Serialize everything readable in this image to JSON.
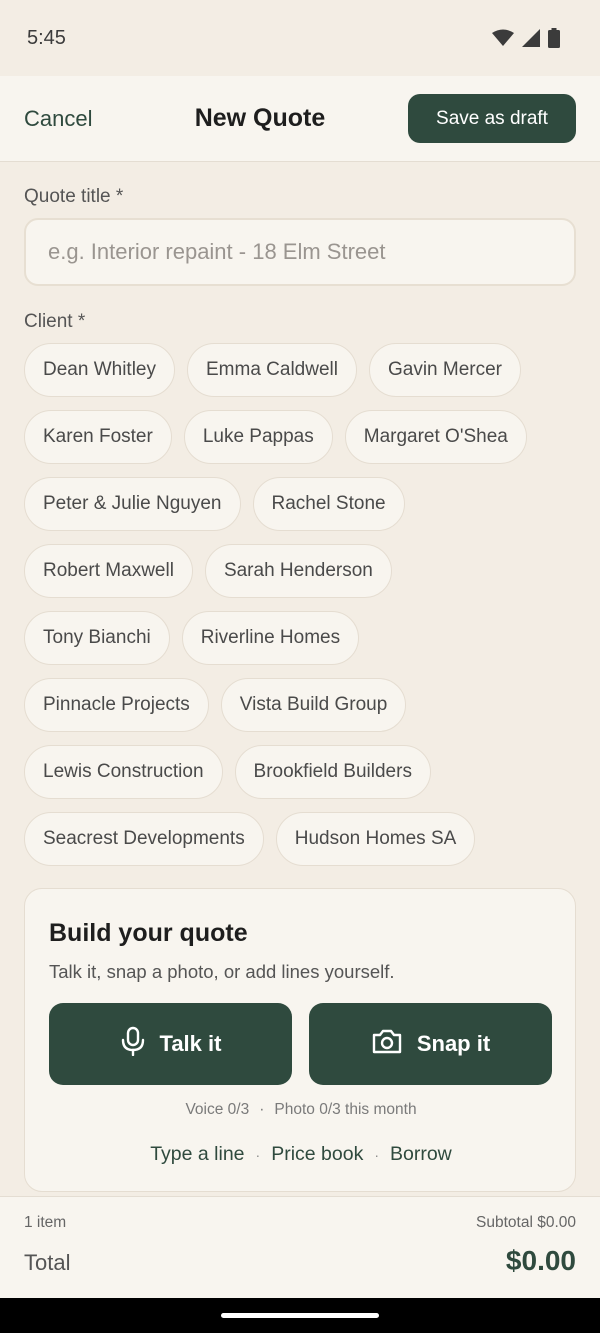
{
  "status_bar": {
    "time": "5:45",
    "icons": [
      "wifi-icon",
      "signal-icon",
      "battery-icon"
    ]
  },
  "header": {
    "cancel_label": "Cancel",
    "title": "New Quote",
    "save_draft_label": "Save as draft"
  },
  "form": {
    "quote_title_label": "Quote title *",
    "quote_title_placeholder": "e.g. Interior repaint - 18 Elm Street",
    "quote_title_value": "",
    "client_label": "Client *",
    "clients": [
      [
        "Dean Whitley",
        "Emma Caldwell",
        "Gavin Mercer"
      ],
      [
        "Karen Foster",
        "Luke Pappas",
        "Margaret O'Shea"
      ],
      [
        "Peter & Julie Nguyen",
        "Rachel Stone"
      ],
      [
        "Robert Maxwell",
        "Sarah Henderson"
      ],
      [
        "Tony Bianchi",
        "Riverline Homes"
      ],
      [
        "Pinnacle Projects",
        "Vista Build Group"
      ],
      [
        "Lewis Construction",
        "Brookfield Builders"
      ],
      [
        "Seacrest Developments",
        "Hudson Homes SA"
      ]
    ]
  },
  "build": {
    "title": "Build your quote",
    "subtitle": "Talk it, snap a photo, or add lines yourself.",
    "talk_label": "Talk it",
    "snap_label": "Snap it",
    "voice_usage": "Voice 0/3",
    "photo_usage": "Photo 0/3 this month",
    "usage_separator": "·",
    "type_line_label": "Type a line",
    "price_book_label": "Price book",
    "borrow_label": "Borrow",
    "link_separator": "·"
  },
  "footer": {
    "item_count": "1 item",
    "subtotal": "Subtotal $0.00",
    "total_label": "Total",
    "total_value": "$0.00"
  },
  "colors": {
    "accent": "#2f4a3e",
    "background": "#f3ede4",
    "surface": "#f8f5ef",
    "border": "#e5ddd1"
  }
}
